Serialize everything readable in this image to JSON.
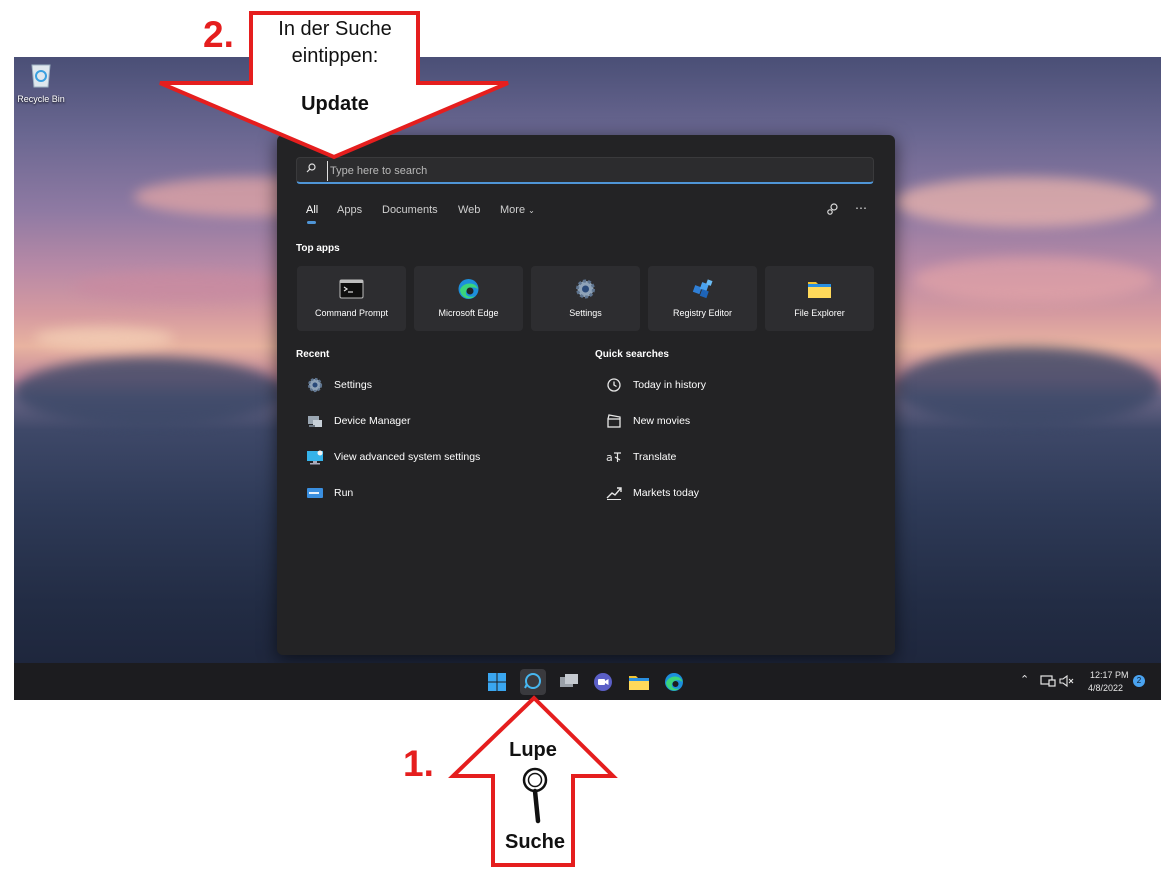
{
  "desktop": {
    "recycle_bin_label": "Recycle Bin"
  },
  "search": {
    "placeholder": "Type here to search",
    "tabs": [
      "All",
      "Apps",
      "Documents",
      "Web",
      "More"
    ],
    "top_apps_title": "Top apps",
    "top_apps": [
      "Command Prompt",
      "Microsoft Edge",
      "Settings",
      "Registry Editor",
      "File Explorer"
    ],
    "recent_title": "Recent",
    "recent": [
      "Settings",
      "Device Manager",
      "View advanced system settings",
      "Run"
    ],
    "quick_title": "Quick searches",
    "quick": [
      "Today in history",
      "New movies",
      "Translate",
      "Markets today"
    ]
  },
  "tray": {
    "time": "12:17 PM",
    "date": "4/8/2022",
    "badge": "2"
  },
  "callouts": {
    "step2_number": "2.",
    "step2_line1": "In der Suche",
    "step2_line2": "eintippen:",
    "step2_word": "Update",
    "step1_number": "1.",
    "step1_top": "Lupe",
    "step1_bottom": "Suche"
  },
  "colors": {
    "accent": "#4f95d6",
    "callout_red": "#e51e1e"
  }
}
